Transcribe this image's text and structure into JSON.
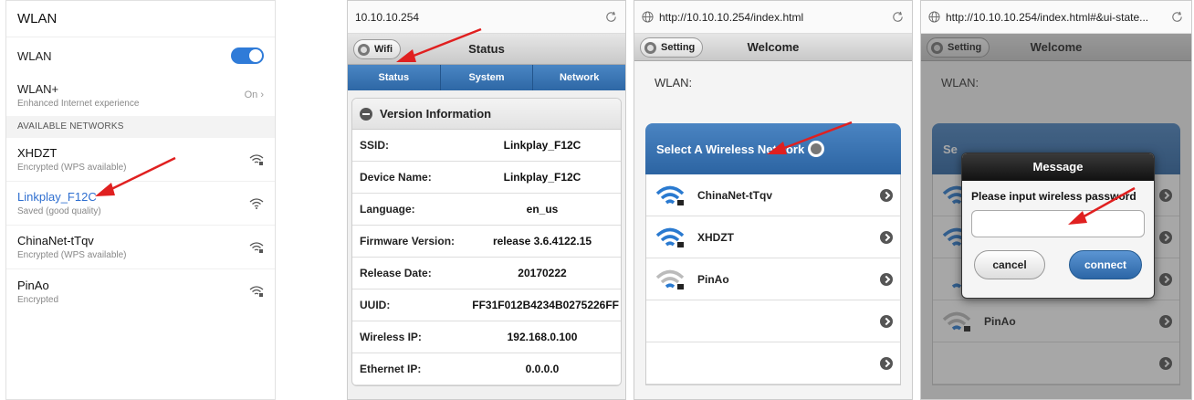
{
  "colors": {
    "accent": "#2f7bd8",
    "blue_bar": "#2c64a2",
    "arrow": "#e02020",
    "selected_network": "#2f6fd0"
  },
  "settings": {
    "title": "WLAN",
    "wlan_label": "WLAN",
    "wlan_toggle": "on",
    "wlan_plus": {
      "title": "WLAN+",
      "subtitle": "Enhanced Internet experience",
      "value": "On"
    },
    "section_header": "AVAILABLE NETWORKS",
    "networks": [
      {
        "name": "XHDZT",
        "status": "Encrypted (WPS available)",
        "icon": "wifi-locked-icon"
      },
      {
        "name": "Linkplay_F12C",
        "status": "Saved (good quality)",
        "icon": "wifi-icon"
      },
      {
        "name": "ChinaNet-tTqv",
        "status": "Encrypted (WPS available)",
        "icon": "wifi-locked-icon"
      },
      {
        "name": "PinAo",
        "status": "Encrypted",
        "icon": "wifi-locked-icon"
      }
    ]
  },
  "status_page": {
    "url": "10.10.10.254",
    "back_button": "Wifi",
    "title": "Status",
    "tabs": [
      "Status",
      "System",
      "Network"
    ],
    "section_title": "Version Information",
    "rows": [
      {
        "key": "SSID:",
        "value": "Linkplay_F12C"
      },
      {
        "key": "Device Name:",
        "value": "Linkplay_F12C"
      },
      {
        "key": "Language:",
        "value": "en_us"
      },
      {
        "key": "Firmware Version:",
        "value": "release 3.6.4122.15"
      },
      {
        "key": "Release Date:",
        "value": "20170222"
      },
      {
        "key": "UUID:",
        "value": "FF31F012B4234B0275226FF"
      },
      {
        "key": "Wireless IP:",
        "value": "192.168.0.100"
      },
      {
        "key": "Ethernet IP:",
        "value": "0.0.0.0"
      }
    ]
  },
  "welcome_page": {
    "url": "http://10.10.10.254/index.html",
    "setting_button": "Setting",
    "title": "Welcome",
    "wlan_label": "WLAN:",
    "select_bar": "Select A Wireless Network",
    "networks": [
      {
        "name": "ChinaNet-tTqv",
        "signal": "strong"
      },
      {
        "name": "XHDZT",
        "signal": "strong"
      },
      {
        "name": "PinAo",
        "signal": "weak"
      },
      {
        "name": ""
      },
      {
        "name": ""
      }
    ]
  },
  "password_page": {
    "url": "http://10.10.10.254/index.html#&ui-state...",
    "setting_button": "Setting",
    "title": "Welcome",
    "wlan_label": "WLAN:",
    "select_bar_partial": "Se",
    "visible_network": "PinAo",
    "dialog": {
      "title": "Message",
      "message": "Please input wireless password",
      "password_value": "",
      "cancel": "cancel",
      "connect": "connect"
    }
  }
}
